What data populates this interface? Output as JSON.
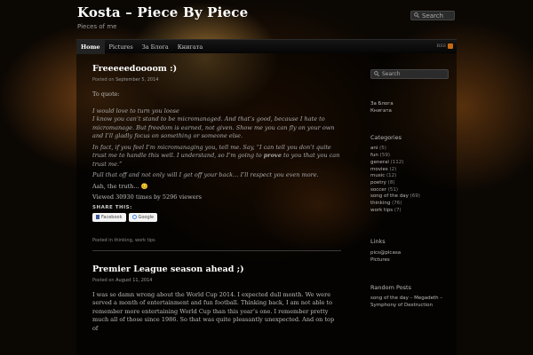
{
  "site": {
    "title": "Kosta – Piece By Piece",
    "description": "Pieces of me"
  },
  "top_search": {
    "placeholder": "Search"
  },
  "nav": {
    "items": [
      "Home",
      "Pictures",
      "За Блога",
      "Книгата"
    ],
    "rss_label": "RSS"
  },
  "post1": {
    "title": "Freeeeedoooom :)",
    "posted_on": "Posted on",
    "date": "September 5, 2014",
    "p1": "To quote:",
    "p2": "I would love to turn you loose",
    "p3": "I know you can’t stand to be micromanaged. And that’s good, because I hate to micromanage. But freedom is earned, not given. Show me you can fly on your own and I’ll gladly focus on something or someone else.",
    "p4a": "In fact, if you feel I’m micromanaging you, tell me. Say, “I can tell you don’t quite trust me to handle this well. I understand, so I’m going to ",
    "p4b": "prove",
    "p4c": " to you that you can trust me.”",
    "p5": "Pull that off and not only will I get off your back… I’ll respect you even more.",
    "p6": "Aah, the truth… 😊",
    "views": "Viewed 30930 times by 5296 viewers",
    "share_title": "SHARE THIS:",
    "share_facebook": "Facebook",
    "share_google": "Google",
    "posted_in": "Posted in thinking, work tips"
  },
  "post2": {
    "title": "Premier League season ahead ;)",
    "posted_on": "Posted on",
    "date": "August 11, 2014",
    "p1": "I was so damn wrong about the World Cup 2014. I expected dull month. We were served a month of entertainment and fun football. Thinking back, I am not able to remember more entertaining World Cup than this year’s one. I remember pretty much all of those since 1986. So that was quite pleasantly unexpected. And on top of"
  },
  "sidebar": {
    "search_placeholder": "Search",
    "pages": [
      "За Блога",
      "Книгата"
    ],
    "categories_title": "Categories",
    "categories": [
      {
        "name": "ani",
        "count": "(5)"
      },
      {
        "name": "fun",
        "count": "(59)"
      },
      {
        "name": "general",
        "count": "(112)"
      },
      {
        "name": "movies",
        "count": "(2)"
      },
      {
        "name": "music",
        "count": "(12)"
      },
      {
        "name": "poetry",
        "count": "(8)"
      },
      {
        "name": "soccer",
        "count": "(51)"
      },
      {
        "name": "song of the day",
        "count": "(69)"
      },
      {
        "name": "thinking",
        "count": "(76)"
      },
      {
        "name": "work tips",
        "count": "(7)"
      }
    ],
    "links_title": "Links",
    "links": [
      "pics@picasa",
      "Pictures"
    ],
    "random_title": "Random Posts",
    "random": [
      "song of the day – Megadeth – Symphony of Destruction"
    ]
  },
  "colors": {
    "accent": "#c76b12",
    "background": "#0b0703",
    "title": "#ffffff"
  }
}
